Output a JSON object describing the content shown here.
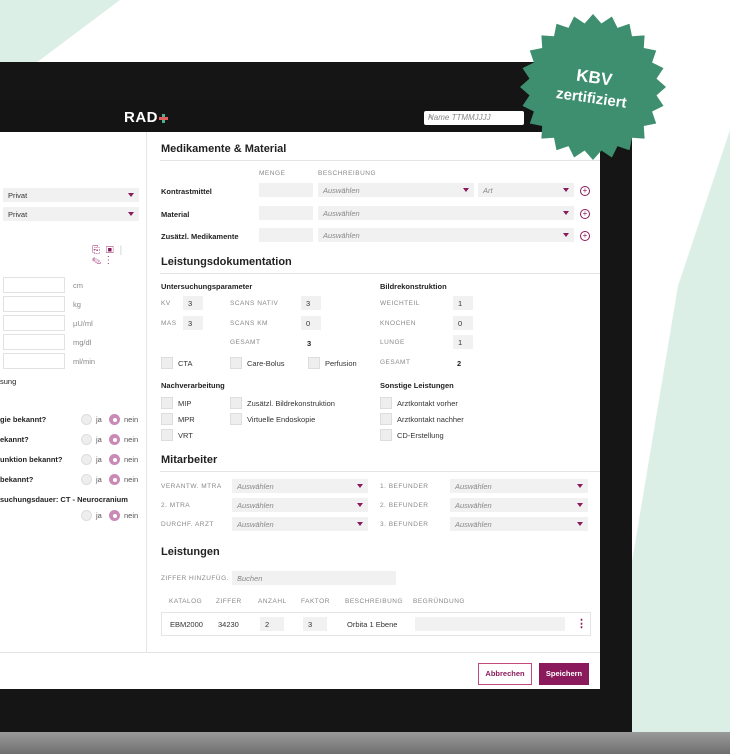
{
  "header": {
    "logo": "RAD",
    "search_placeholder": "Name TTMMJJJJ"
  },
  "badge": {
    "line1": "KBV",
    "line2": "zertifiziert"
  },
  "left_panel": {
    "selects": [
      "Privat",
      "Privat"
    ],
    "measurements": [
      {
        "unit": "cm"
      },
      {
        "unit": "kg"
      },
      {
        "unit": "µU/ml"
      },
      {
        "unit": "mg/dl"
      },
      {
        "unit": "ml/min"
      }
    ],
    "partial_label": "sung",
    "questions": [
      {
        "label": "gie bekannt?",
        "ja": "ja",
        "nein": "nein"
      },
      {
        "label": "ekannt?",
        "ja": "ja",
        "nein": "nein"
      },
      {
        "label": "unktion bekannt?",
        "ja": "ja",
        "nein": "nein"
      },
      {
        "label": "bekannt?",
        "ja": "ja",
        "nein": "nein"
      },
      {
        "label": "suchungsdauer: CT - Neurocranium",
        "ja": "ja",
        "nein": "nein"
      }
    ]
  },
  "medikamente": {
    "title": "Medikamente & Material",
    "col_menge": "MENGE",
    "col_beschreibung": "BESCHREIBUNG",
    "rows": [
      {
        "label": "Kontrastmittel",
        "select": "Auswählen",
        "art": "Art"
      },
      {
        "label": "Material",
        "select": "Auswählen"
      },
      {
        "label": "Zusätzl. Medikamente",
        "select": "Auswählen"
      }
    ]
  },
  "leistungsdoku": {
    "title": "Leistungsdokumentation",
    "untersuchung_title": "Untersuchungsparameter",
    "kv_label": "KV",
    "kv_value": "3",
    "mas_label": "MAS",
    "mas_value": "3",
    "scans_nativ_label": "SCANS NATIV",
    "scans_nativ_value": "3",
    "scans_km_label": "SCANS KM",
    "scans_km_value": "0",
    "gesamt_label": "GESAMT",
    "gesamt_value": "3",
    "bildrek_title": "Bildrekonstruktion",
    "weichteil_label": "WEICHTEIL",
    "weichteil_value": "1",
    "knochen_label": "KNOCHEN",
    "knochen_value": "0",
    "lunge_label": "LUNGE",
    "lunge_value": "1",
    "bild_gesamt_label": "GESAMT",
    "bild_gesamt_value": "2",
    "checks1": [
      "CTA",
      "Care-Bolus",
      "Perfusion"
    ],
    "nachverarbeitung_title": "Nachverarbeitung",
    "nach_items": [
      "MIP",
      "MPR",
      "VRT"
    ],
    "zus_bild": "Zusätzl. Bildrekonstruktion",
    "virt_endo": "Virtuelle Endoskopie",
    "sonstige_title": "Sonstige Leistungen",
    "sonstige_items": [
      "Arztkontakt vorher",
      "Arztkontakt nachher",
      "CD-Erstellung"
    ]
  },
  "mitarbeiter": {
    "title": "Mitarbeiter",
    "left": [
      {
        "label": "VERANTW. MTRA",
        "value": "Auswählen"
      },
      {
        "label": "2. MTRA",
        "value": "Auswählen"
      },
      {
        "label": "DURCHF. ARZT",
        "value": "Auswählen"
      }
    ],
    "right": [
      {
        "label": "1. BEFUNDER",
        "value": "Auswählen"
      },
      {
        "label": "2. BEFUNDER",
        "value": "Auswählen"
      },
      {
        "label": "3. BEFUNDER",
        "value": "Auswählen"
      }
    ]
  },
  "leistungen": {
    "title": "Leistungen",
    "ziffer_label": "ZIFFER HINZUFÜG.",
    "search_placeholder": "Suchen",
    "columns": [
      "KATALOG",
      "ZIFFER",
      "ANZAHL",
      "FAKTOR",
      "BESCHREIBUNG",
      "BEGRÜNDUNG"
    ],
    "row": {
      "katalog": "EBM2000",
      "ziffer": "34230",
      "anzahl": "2",
      "faktor": "3",
      "beschreibung": "Orbita 1 Ebene"
    }
  },
  "footer": {
    "cancel": "Abbrechen",
    "save": "Speichern"
  },
  "colors": {
    "accent": "#8b1a5c",
    "badge": "#3e8f70",
    "bg_green": "#dcefe6"
  }
}
